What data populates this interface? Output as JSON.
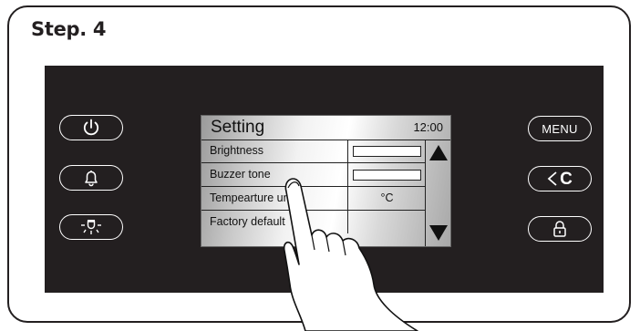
{
  "step": {
    "title": "Step. 4"
  },
  "left_buttons": [
    {
      "name": "power-button",
      "icon": "power-icon"
    },
    {
      "name": "alarm-button",
      "icon": "bell-icon"
    },
    {
      "name": "light-button",
      "icon": "lamp-icon"
    }
  ],
  "right_buttons": {
    "menu_label": "MENU",
    "back_label": "C",
    "lock_icon": "lock-icon"
  },
  "lcd": {
    "title": "Setting",
    "time": "12:00",
    "rows": [
      {
        "label": "Brightness",
        "value_type": "bar"
      },
      {
        "label": "Buzzer tone",
        "value_type": "bar"
      },
      {
        "label": "Tempearture units",
        "value": "°C"
      },
      {
        "label": "Factory default",
        "value": ""
      }
    ],
    "scroll_up": "up-arrow-icon",
    "scroll_down": "down-arrow-icon"
  },
  "overlay": {
    "hand": "pointing-hand-icon"
  },
  "colors": {
    "panel": "#231f20",
    "frame_border": "#231f20",
    "button_outline": "#ffffff"
  }
}
